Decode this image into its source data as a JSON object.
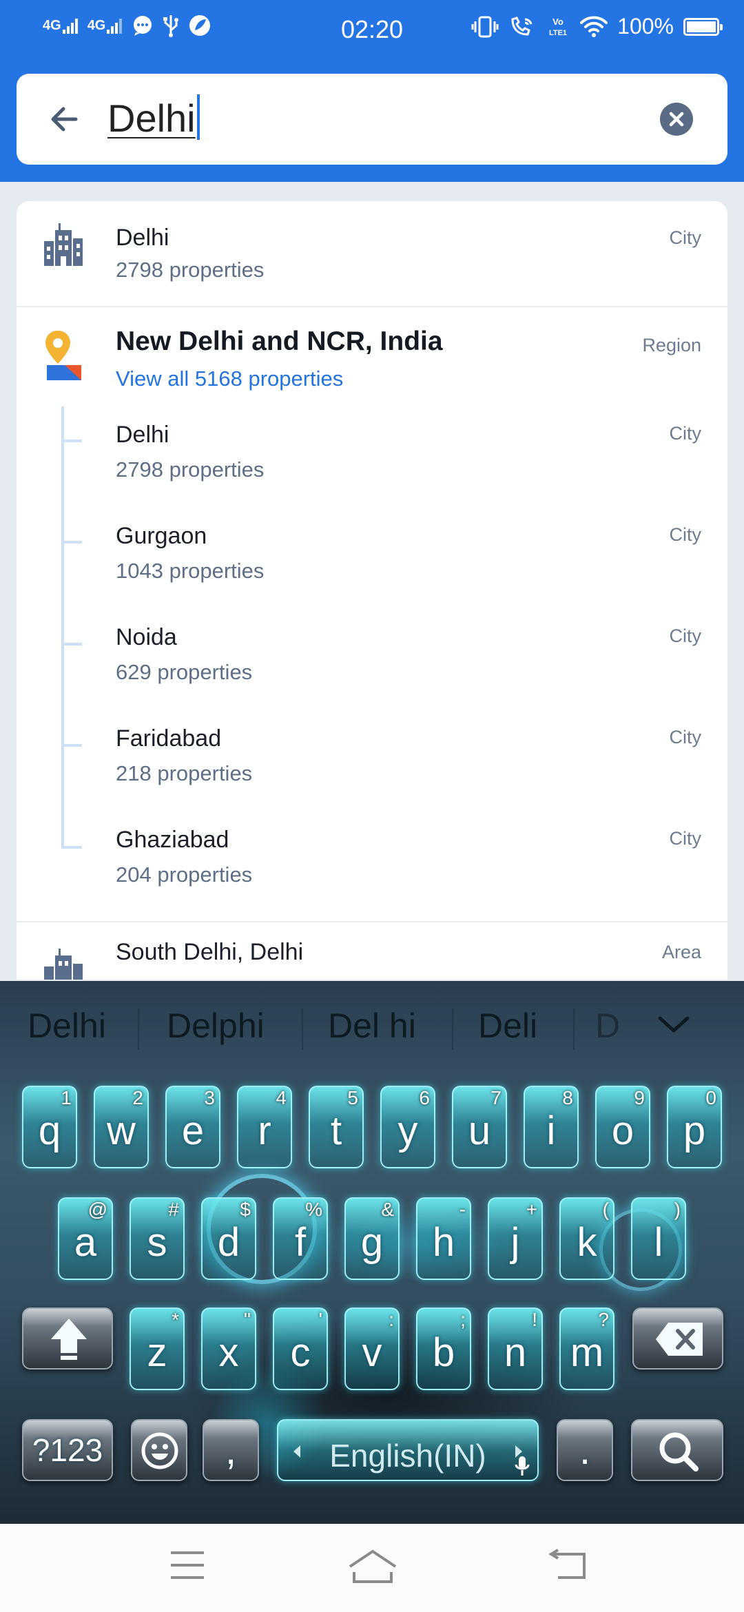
{
  "status_bar": {
    "sim1": "4G",
    "sim2": "4G",
    "time": "02:20",
    "volte": "Vo LTE1",
    "battery": "100%",
    "battery_level": 1.0,
    "icons": [
      "signal-icon",
      "chat-icon",
      "usb-icon",
      "app-notification-icon",
      "vibrate-icon",
      "wifi-calling-icon",
      "volte-icon",
      "wifi-icon",
      "battery-icon"
    ]
  },
  "search": {
    "query": "Delhi",
    "back_icon": "arrow-left-icon",
    "clear_icon": "close-circle-icon"
  },
  "results": [
    {
      "name": "Delhi",
      "sub": "2798 properties",
      "type": "City",
      "icon": "city-buildings-icon"
    },
    {
      "name": "New Delhi and NCR, India",
      "sub": "View all 5168 properties",
      "type": "Region",
      "icon": "map-pin-icon"
    },
    {
      "name": "Delhi",
      "sub": "2798 properties",
      "type": "City"
    },
    {
      "name": "Gurgaon",
      "sub": "1043 properties",
      "type": "City"
    },
    {
      "name": "Noida",
      "sub": "629 properties",
      "type": "City"
    },
    {
      "name": "Faridabad",
      "sub": "218 properties",
      "type": "City"
    },
    {
      "name": "Ghaziabad",
      "sub": "204 properties",
      "type": "City"
    },
    {
      "name": "South Delhi, Delhi",
      "sub": "",
      "type": "Area",
      "icon": "city-buildings-icon"
    }
  ],
  "keyboard": {
    "suggestions": [
      "Delhi",
      "Delphi",
      "Del hi",
      "Deli",
      "D"
    ],
    "row1": [
      {
        "k": "q",
        "h": "1"
      },
      {
        "k": "w",
        "h": "2"
      },
      {
        "k": "e",
        "h": "3"
      },
      {
        "k": "r",
        "h": "4"
      },
      {
        "k": "t",
        "h": "5"
      },
      {
        "k": "y",
        "h": "6"
      },
      {
        "k": "u",
        "h": "7"
      },
      {
        "k": "i",
        "h": "8"
      },
      {
        "k": "o",
        "h": "9"
      },
      {
        "k": "p",
        "h": "0"
      }
    ],
    "row2": [
      {
        "k": "a",
        "h": "@"
      },
      {
        "k": "s",
        "h": "#"
      },
      {
        "k": "d",
        "h": "$"
      },
      {
        "k": "f",
        "h": "%"
      },
      {
        "k": "g",
        "h": "&"
      },
      {
        "k": "h",
        "h": "-"
      },
      {
        "k": "j",
        "h": "+"
      },
      {
        "k": "k",
        "h": "("
      },
      {
        "k": "l",
        "h": ")"
      }
    ],
    "row3": [
      {
        "k": "z",
        "h": "*"
      },
      {
        "k": "x",
        "h": "\""
      },
      {
        "k": "c",
        "h": "'"
      },
      {
        "k": "v",
        "h": ":"
      },
      {
        "k": "b",
        "h": ";"
      },
      {
        "k": "n",
        "h": "!"
      },
      {
        "k": "m",
        "h": "?"
      }
    ],
    "symbols_label": "?123",
    "comma": ",",
    "space_label": "English(IN)",
    "period": ".",
    "shift_icon": "shift-arrow-icon",
    "backspace_icon": "backspace-icon",
    "emoji_icon": "emoji-icon",
    "search_icon": "search-icon",
    "collapse_icon": "chevron-down-icon",
    "mic_icon": "mic-icon"
  },
  "nav_bar": {
    "icons": [
      "menu-icon",
      "home-icon",
      "back-icon"
    ]
  },
  "colors": {
    "brand": "#2474e4",
    "link": "#2374e1",
    "muted_text": "#5f6e87",
    "key_glow": "#46e0ee"
  }
}
